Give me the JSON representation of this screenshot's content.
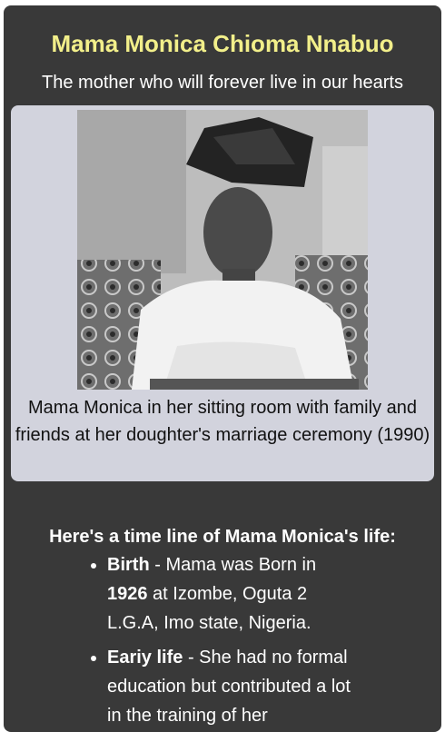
{
  "header": {
    "title": "Mama Monica Chioma Nnabuo",
    "subtitle": "The mother who will forever live in our hearts"
  },
  "figure": {
    "caption": "Mama Monica in her sitting room with family and friends at her doughter's marriage ceremony (1990)"
  },
  "timeline": {
    "heading": "Here's a time line of Mama Monica's life:",
    "items": [
      {
        "term": "Birth",
        "text_1": " - Mama was Born in ",
        "year": "1926",
        "text_2": " at Izombe, Oguta 2 L.G.A, Imo state, Nigeria."
      },
      {
        "term": "Eariy life",
        "text_1": " - She had no formal education but contributed a lot in the training of her"
      }
    ]
  },
  "colors": {
    "page_bg": "#393939",
    "title": "#f2ef8a",
    "figure_bg": "#d2d3dd"
  }
}
